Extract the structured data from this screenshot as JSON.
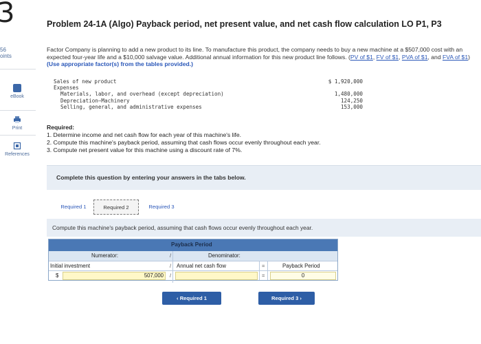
{
  "question_number": "3",
  "points": "56",
  "points_label": "oints",
  "sidebar": {
    "tools": [
      {
        "label": "eBook",
        "icon": "ebook-icon"
      },
      {
        "label": "Print",
        "icon": "print-icon"
      },
      {
        "label": "References",
        "icon": "references-icon"
      }
    ]
  },
  "problem": {
    "title": "Problem 24-1A (Algo) Payback period, net present value, and net cash flow calculation LO P1, P3",
    "intro_text": "Factor Company is planning to add a new product to its line. To manufacture this product, the company needs to buy a new machine at a $507,000 cost with an expected four-year life and a $10,000 salvage value. Additional annual information for this new product line follows.",
    "links": [
      "PV of $1",
      "FV of $1",
      "PVA of $1",
      "FVA of $1"
    ],
    "instruction": "(Use appropriate factor(s) from the tables provided.)"
  },
  "financials": {
    "sales_label": "Sales of new product",
    "sales_value": "$ 1,920,000",
    "expenses_label": "Expenses",
    "expense_items": [
      {
        "label": "Materials, labor, and overhead (except depreciation)",
        "value": "1,480,000"
      },
      {
        "label": "Depreciation—Machinery",
        "value": "124,250"
      },
      {
        "label": "Selling, general, and administrative expenses",
        "value": "153,000"
      }
    ]
  },
  "required": {
    "heading": "Required:",
    "items": [
      "1. Determine income and net cash flow for each year of this machine's life.",
      "2. Compute this machine's payback period, assuming that cash flows occur evenly throughout each year.",
      "3. Compute net present value for this machine using a discount rate of 7%."
    ]
  },
  "complete_banner": "Complete this question by entering your answers in the tabs below.",
  "tabs": [
    {
      "label": "Required 1",
      "active": false
    },
    {
      "label": "Required 2",
      "active": true
    },
    {
      "label": "Required 3",
      "active": false
    }
  ],
  "task_text": "Compute this machine's payback period, assuming that cash flows occur evenly throughout each year.",
  "payback_table": {
    "title": "Payback Period",
    "numerator_label": "Numerator:",
    "denominator_label": "Denominator:",
    "op_divide": "/",
    "op_equals": "=",
    "numerator_item": "Initial investment",
    "denominator_item": "Annual net cash flow",
    "result_label": "Payback Period",
    "currency": "$",
    "numerator_value": "507,000",
    "denominator_value": "",
    "result_value": "0"
  },
  "nav": {
    "prev_label": "Required 1",
    "next_label": "Required 3"
  },
  "colors": {
    "header_blue": "#4a78b5",
    "button_blue": "#2e5ea6",
    "input_yellow": "#fff8c8",
    "link_blue": "#2a57b8"
  }
}
